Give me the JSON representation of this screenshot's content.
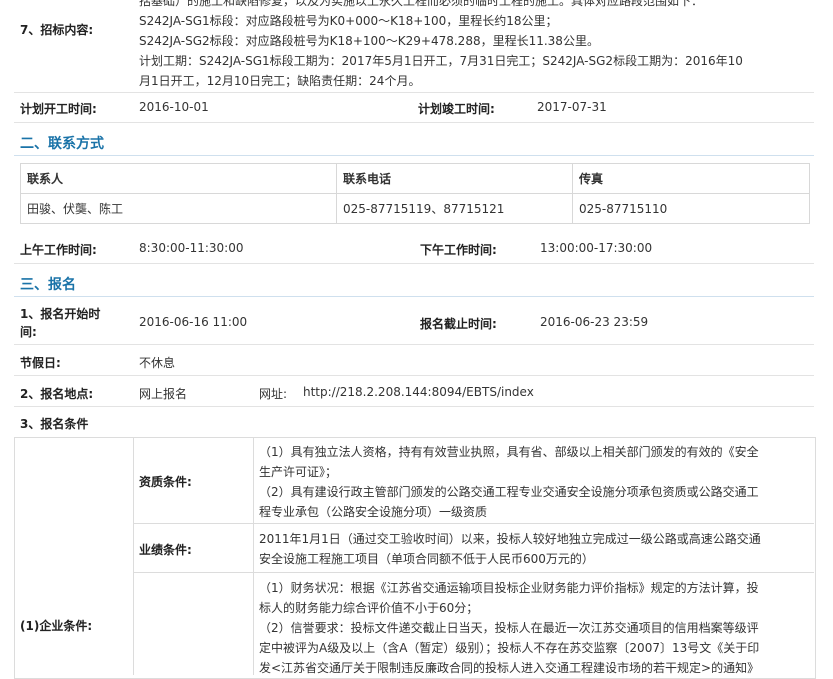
{
  "tender_content": {
    "label": "7、招标内容:",
    "lines": [
      "括基础）的施工和缺陷修复，以及为实施以上永久工程而必须的临时工程的施工。具体对应路段范围如下：",
      "S242JA-SG1标段：对应路段桩号为K0+000～K18+100，里程长约18公里；",
      "S242JA-SG2标段：对应路段桩号为K18+100～K29+478.288，里程长11.38公里。",
      "计划工期：S242JA-SG1标段工期为：2017年5月1日开工，7月31日完工；S242JA-SG2标段工期为：2016年10",
      "月1日开工，12月10日完工；缺陷责任期：24个月。"
    ]
  },
  "schedule": {
    "start_label": "计划开工时间:",
    "start_value": "2016-10-01",
    "end_label": "计划竣工时间:",
    "end_value": "2017-07-31"
  },
  "contact_section": {
    "title": "二、联系方式",
    "headers": [
      "联系人",
      "联系电话",
      "传真"
    ],
    "row": [
      "田骏、伏龑、陈工",
      "025-87715119、87715121",
      "025-87715110"
    ]
  },
  "work_hours": {
    "am_label": "上午工作时间:",
    "am_value": "8:30:00-11:30:00",
    "pm_label": "下午工作时间:",
    "pm_value": "13:00:00-17:30:00"
  },
  "registration": {
    "title": "三、报名",
    "start_label_1": "1、报名开始时",
    "start_label_2": "间:",
    "start_value": "2016-06-16 11:00",
    "end_label": "报名截止时间:",
    "end_value": "2016-06-23 23:59",
    "holiday_label": "节假日:",
    "holiday_value": "不休息",
    "place_label": "2、报名地点:",
    "place_value": "网上报名",
    "url_label": "网址:",
    "url_value": "http://218.2.208.144:8094/EBTS/index",
    "conditions_label": "3、报名条件"
  },
  "conditions": {
    "qualification_label": "资质条件:",
    "qualification_lines": [
      "（1）具有独立法人资格，持有有效营业执照，具有省、部级以上相关部门颁发的有效的《安全",
      "生产许可证》；",
      "（2）具有建设行政主管部门颁发的公路交通工程专业交通安全设施分项承包资质或公路交通工",
      "程专业承包（公路安全设施分项）一级资质"
    ],
    "performance_label": "业绩条件:",
    "performance_lines": [
      "2011年1月1日（通过交工验收时间）以来，投标人较好地独立完成过一级公路或高速公路交通",
      "安全设施工程施工项目（单项合同额不低于人民币600万元的）"
    ],
    "enterprise_label": "(1)企业条件:",
    "enterprise_lines": [
      "（1）财务状况：根据《江苏省交通运输项目投标企业财务能力评价指标》规定的方法计算，投",
      "标人的财务能力综合评价值不小于60分；",
      "（2）信誉要求：投标文件递交截止日当天，投标人在最近一次江苏交通项目的信用档案等级评",
      "定中被评为A级及以上（含A（暂定）级别）；投标人不存在苏交监察〔2007〕13号文《关于印",
      "发<江苏省交通厅关于限制违反廉政合同的投标人进入交通工程建设市场的若干规定>的通知》"
    ]
  }
}
